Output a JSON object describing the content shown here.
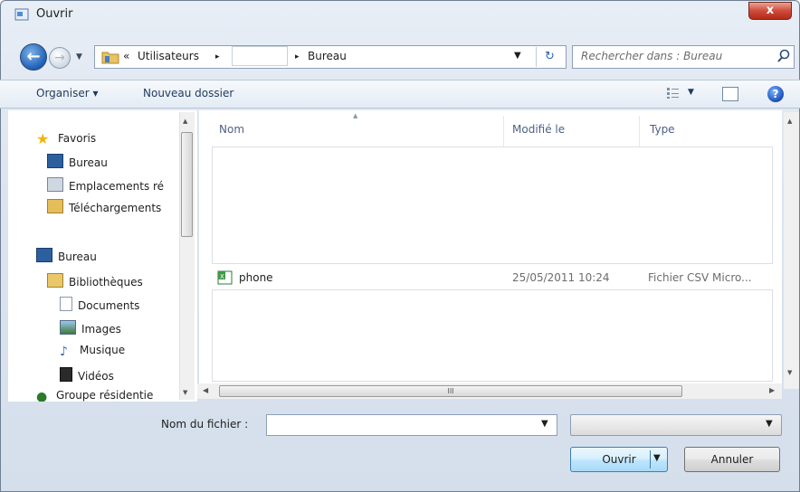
{
  "window": {
    "title": "Ouvrir",
    "close_label": "x"
  },
  "address": {
    "prefix": "«",
    "crumb1": "Utilisateurs",
    "sep": "▸",
    "crumb3": "Bureau"
  },
  "search": {
    "placeholder": "Rechercher dans : Bureau"
  },
  "toolbar": {
    "organize": "Organiser ▾",
    "new_folder": "Nouveau dossier"
  },
  "nav": {
    "favorites": {
      "label": "Favoris",
      "items": [
        "Bureau",
        "Emplacements ré",
        "Téléchargements"
      ]
    },
    "desktop": {
      "label": "Bureau"
    },
    "libraries": {
      "label": "Bibliothèques",
      "items": [
        "Documents",
        "Images",
        "Musique",
        "Vidéos"
      ]
    },
    "homegroup": {
      "label": "Groupe résidentie"
    }
  },
  "columns": {
    "name": "Nom",
    "modified": "Modifié le",
    "type": "Type"
  },
  "files": [
    {
      "name": "phone",
      "modified": "25/05/2011 10:24",
      "type": "Fichier CSV Micro..."
    }
  ],
  "bottom": {
    "filename_label": "Nom du fichier :",
    "filename_value": "",
    "filter_value": "",
    "open_label": "Ouvrir",
    "cancel_label": "Annuler"
  },
  "hscroll_grip": "III",
  "icons": [
    "back-icon",
    "forward-icon",
    "folder-icon",
    "refresh-icon",
    "search-icon",
    "views-icon",
    "preview-pane-icon",
    "help-icon",
    "star-icon",
    "desktop-icon",
    "network-places-icon",
    "downloads-icon",
    "library-icon",
    "document-icon",
    "images-icon",
    "music-icon",
    "videos-icon",
    "homegroup-icon",
    "csv-file-icon"
  ]
}
